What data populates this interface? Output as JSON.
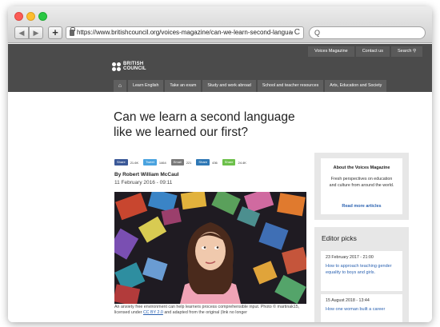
{
  "browser": {
    "url": "https://www.britishcouncil.org/voices-magazine/can-we-learn-second-language-we-learned-",
    "back_glyph": "◀",
    "forward_glyph": "▶",
    "add_glyph": "+",
    "reload_glyph": "C",
    "search_glyph": "Q"
  },
  "header": {
    "top_links": [
      "Voices Magazine",
      "Contact us",
      "Search"
    ],
    "logo_line1": "BRITISH",
    "logo_line2": "COUNCIL",
    "nav": [
      "Learn English",
      "Take an exam",
      "Study and work abroad",
      "School and teacher resources",
      "Arts, Education and Society"
    ],
    "home_icon": "home-icon"
  },
  "article": {
    "title": "Can we learn a second language like we learned our first?",
    "share": [
      {
        "label": "Share",
        "count": "21.6K",
        "color": "#3b5998"
      },
      {
        "label": "Tweet",
        "count": "1464",
        "color": "#4aa3df"
      },
      {
        "label": "Email",
        "count": "221",
        "color": "#7a7a7a"
      },
      {
        "label": "Share",
        "count": "436",
        "color": "#2f78b5"
      },
      {
        "label": "Share",
        "count": "24.4K",
        "color": "#6cc04a"
      }
    ],
    "author": "By Robert William McCaul",
    "date": "11 February 2016 - 09:11",
    "caption_prefix": "An anxiety free environment can help learners process comprehensible input. Photo ©",
    "caption_middle": "martinak15, licensed under",
    "caption_link": "CC BY 2.0",
    "caption_suffix": "and adapted from the original (link no longer"
  },
  "sidebar": {
    "about_title": "About the Voices Magazine",
    "about_text": "Fresh perspectives on education and culture from around the world.",
    "about_link": "Read more articles",
    "picks_title": "Editor picks",
    "picks": [
      {
        "date": "23 February 2017 - 21:00",
        "title": "How to approach teaching gender equality to boys and girls."
      },
      {
        "date": "15 August 2018 - 13:44",
        "title": "How one woman built a career"
      }
    ]
  },
  "colors": {
    "header_bg": "#4b4b4b",
    "link_blue": "#2b62b1",
    "sidebar_bg": "#e7e7e7"
  }
}
